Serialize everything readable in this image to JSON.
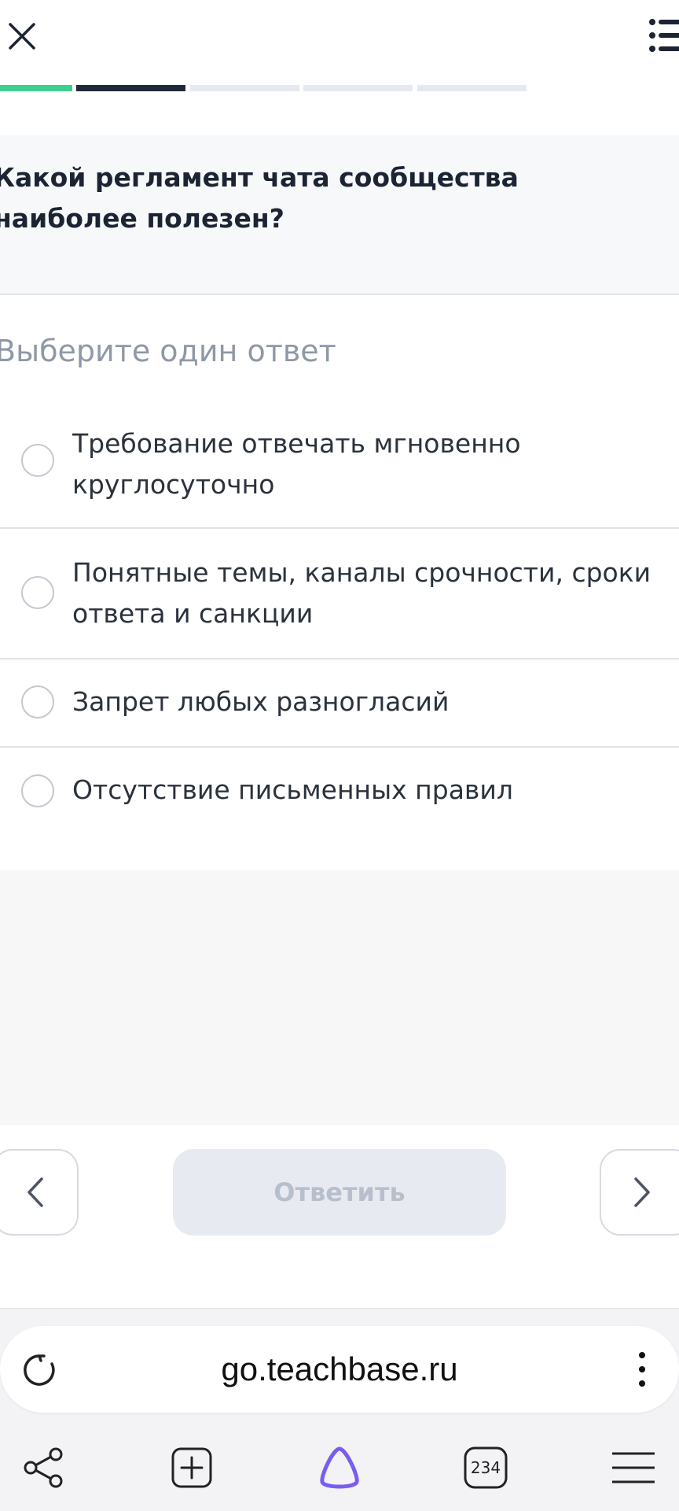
{
  "quiz": {
    "question": "Какой регламент чата сообщества наиболее полезен?",
    "hint": "Выберите один ответ",
    "options": [
      "Требование отвечать мгновенно круглосуточно",
      "Понятные темы, каналы срочности, сроки ответа и санкции",
      "Запрет любых разногласий",
      "Отсутствие письменных правил"
    ],
    "answer_label": "Ответить"
  },
  "progress": {
    "total_segments": 5,
    "current_segment": 2,
    "colors": {
      "done": "#3ccf8e",
      "current": "#1f2a3a",
      "pending": "#e6e9f1"
    }
  },
  "icons": {
    "close": "close-icon",
    "list": "list-icon",
    "prev": "chevron-left-icon",
    "next": "chevron-right-icon",
    "reload": "reload-icon",
    "more": "more-vertical-icon",
    "share": "share-icon",
    "new_tab": "plus-square-icon",
    "assistant": "alice-icon",
    "menu": "hamburger-icon"
  },
  "browser": {
    "url": "go.teachbase.ru",
    "tab_count": "234"
  },
  "colors": {
    "accent_green": "#3ccf8e",
    "text_dark": "#1c2433",
    "assistant_purple": "#7b5cf0"
  }
}
